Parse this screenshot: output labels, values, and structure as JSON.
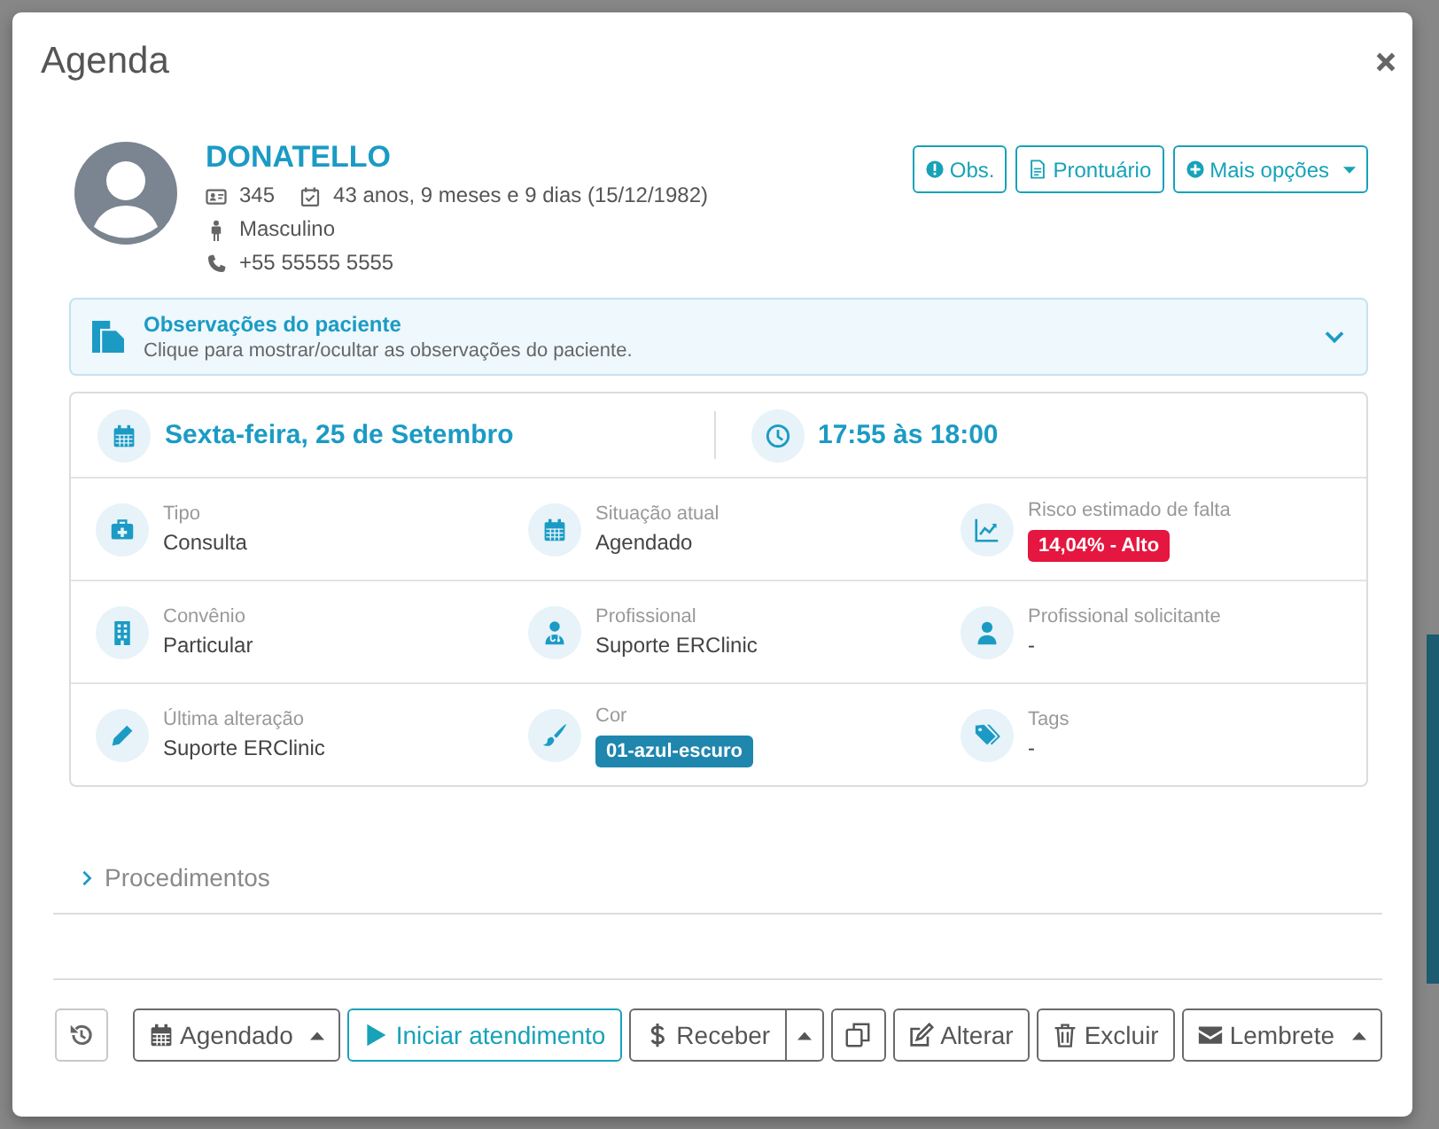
{
  "modal": {
    "title": "Agenda"
  },
  "patient": {
    "name": "DONATELLO",
    "record_number": "345",
    "age": "43 anos, 9 meses e 9 dias (15/12/1982)",
    "sex": "Masculino",
    "phone": "+55 55555 5555"
  },
  "header_buttons": [
    {
      "kind": "notes",
      "label": "Obs."
    },
    {
      "kind": "record",
      "label": "Prontuário"
    },
    {
      "kind": "more",
      "label": "Mais opções"
    }
  ],
  "observations": {
    "title": "Observações do paciente",
    "hint": "Clique para mostrar/ocultar as observações do paciente.",
    "expanded": false
  },
  "appointment": {
    "date": "Sexta-feira, 25 de Setembro",
    "time": "17:55 às 18:00",
    "rows": [
      {
        "fields": [
          {
            "kind": "type",
            "label": "Tipo",
            "value": "Consulta"
          },
          {
            "kind": "status",
            "label": "Situação atual",
            "value": "Agendado"
          },
          {
            "kind": "risk",
            "label": "Risco estimado de falta",
            "badge": "14,04% - Alto",
            "color": "#e5163f"
          }
        ]
      },
      {
        "fields": [
          {
            "kind": "insurance",
            "label": "Convênio",
            "value": "Particular"
          },
          {
            "kind": "professional",
            "label": "Profissional",
            "value": "Suporte ERClinic"
          },
          {
            "kind": "requester",
            "label": "Profissional solicitante",
            "value": "-"
          }
        ]
      },
      {
        "fields": [
          {
            "kind": "edited",
            "label": "Última alteração",
            "value": "Suporte ERClinic"
          },
          {
            "kind": "color",
            "label": "Cor",
            "badge": "01-azul-escuro",
            "color": "#1f86ad"
          },
          {
            "kind": "tags",
            "label": "Tags",
            "value": "-"
          }
        ]
      }
    ]
  },
  "procedures": {
    "label": "Procedimentos",
    "expanded": false
  },
  "footer_buttons": [
    {
      "kind": "history"
    },
    {
      "kind": "status",
      "label": "Agendado"
    },
    {
      "kind": "start",
      "label": "Iniciar atendimento"
    },
    {
      "kind": "receive",
      "label": "Receber"
    },
    {
      "kind": "receivemenu"
    },
    {
      "kind": "copy"
    },
    {
      "kind": "edit",
      "label": "Alterar"
    },
    {
      "kind": "delete",
      "label": "Excluir"
    },
    {
      "kind": "reminder",
      "label": "Lembrete"
    }
  ]
}
